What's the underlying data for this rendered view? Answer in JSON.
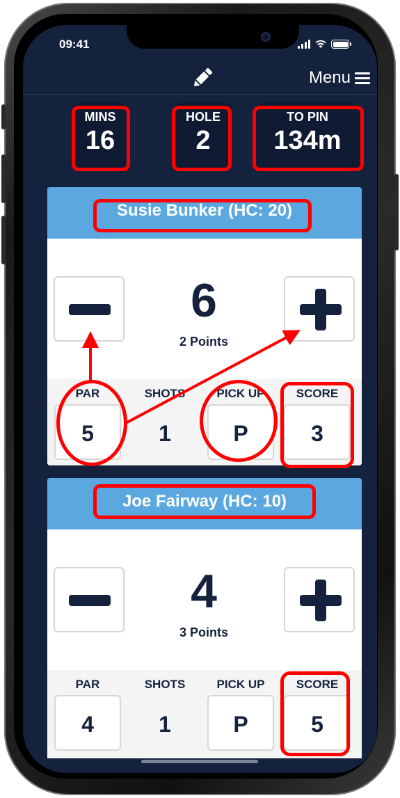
{
  "status_bar": {
    "time": "09:41"
  },
  "header": {
    "menu_label": "Menu",
    "edit_icon": "pencil-icon",
    "menu_icon": "hamburger-icon"
  },
  "stats": [
    {
      "label": "MINS",
      "value": "16"
    },
    {
      "label": "HOLE",
      "value": "2"
    },
    {
      "label": "TO PIN",
      "value": "134m"
    }
  ],
  "players": [
    {
      "name": "Susie Bunker (HC: 20)",
      "score": "6",
      "points": "2 Points",
      "columns": [
        {
          "label": "PAR",
          "value": "5"
        },
        {
          "label": "SHOTS",
          "value": "1"
        },
        {
          "label": "PICK UP",
          "value": "P"
        },
        {
          "label": "SCORE",
          "value": "3"
        }
      ]
    },
    {
      "name": "Joe Fairway (HC: 10)",
      "score": "4",
      "points": "3 Points",
      "columns": [
        {
          "label": "PAR",
          "value": "4"
        },
        {
          "label": "SHOTS",
          "value": "1"
        },
        {
          "label": "PICK UP",
          "value": "P"
        },
        {
          "label": "SCORE",
          "value": "5"
        }
      ]
    }
  ],
  "colors": {
    "background": "#14223d",
    "card_header": "#5aa8df",
    "annotation": "#ff0000"
  }
}
